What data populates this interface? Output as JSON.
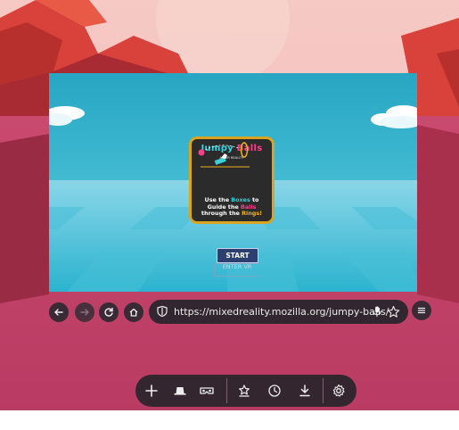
{
  "game": {
    "title_part1": "Jumpy",
    "title_part2": "Balls",
    "subtitle": "AN XR REALITY",
    "instructions": {
      "line1_a": "Use the ",
      "line1_b": "Boxes",
      "line1_c": " to",
      "line2_a": "Guide the ",
      "line2_b": "Balls",
      "line3_a": "through the ",
      "line3_b": "Rings!"
    },
    "start_label": "START",
    "enter_vr_label": "ENTER VR"
  },
  "navbar": {
    "back_icon": "back-arrow-icon",
    "forward_icon": "forward-arrow-icon",
    "reload_icon": "reload-icon",
    "home_icon": "home-icon",
    "url": "https://mixedreality.mozilla.org/jumpy-balls/",
    "shield_icon": "tracking-shield-icon",
    "mic_icon": "microphone-icon",
    "bookmark_icon": "star-icon",
    "menu_icon": "hamburger-menu-icon"
  },
  "tray": {
    "items": [
      {
        "icon": "plus-icon"
      },
      {
        "icon": "private-mode-hat-icon"
      },
      {
        "icon": "vr-headset-icon"
      },
      {
        "icon": "bookmarks-icon"
      },
      {
        "icon": "history-clock-icon"
      },
      {
        "icon": "downloads-icon"
      },
      {
        "icon": "settings-gear-icon"
      }
    ]
  },
  "colors": {
    "accent_cyan": "#2fd4e0",
    "accent_pink": "#ff3d8a",
    "accent_yellow": "#f2b21c",
    "bar_bg": "#322730"
  }
}
